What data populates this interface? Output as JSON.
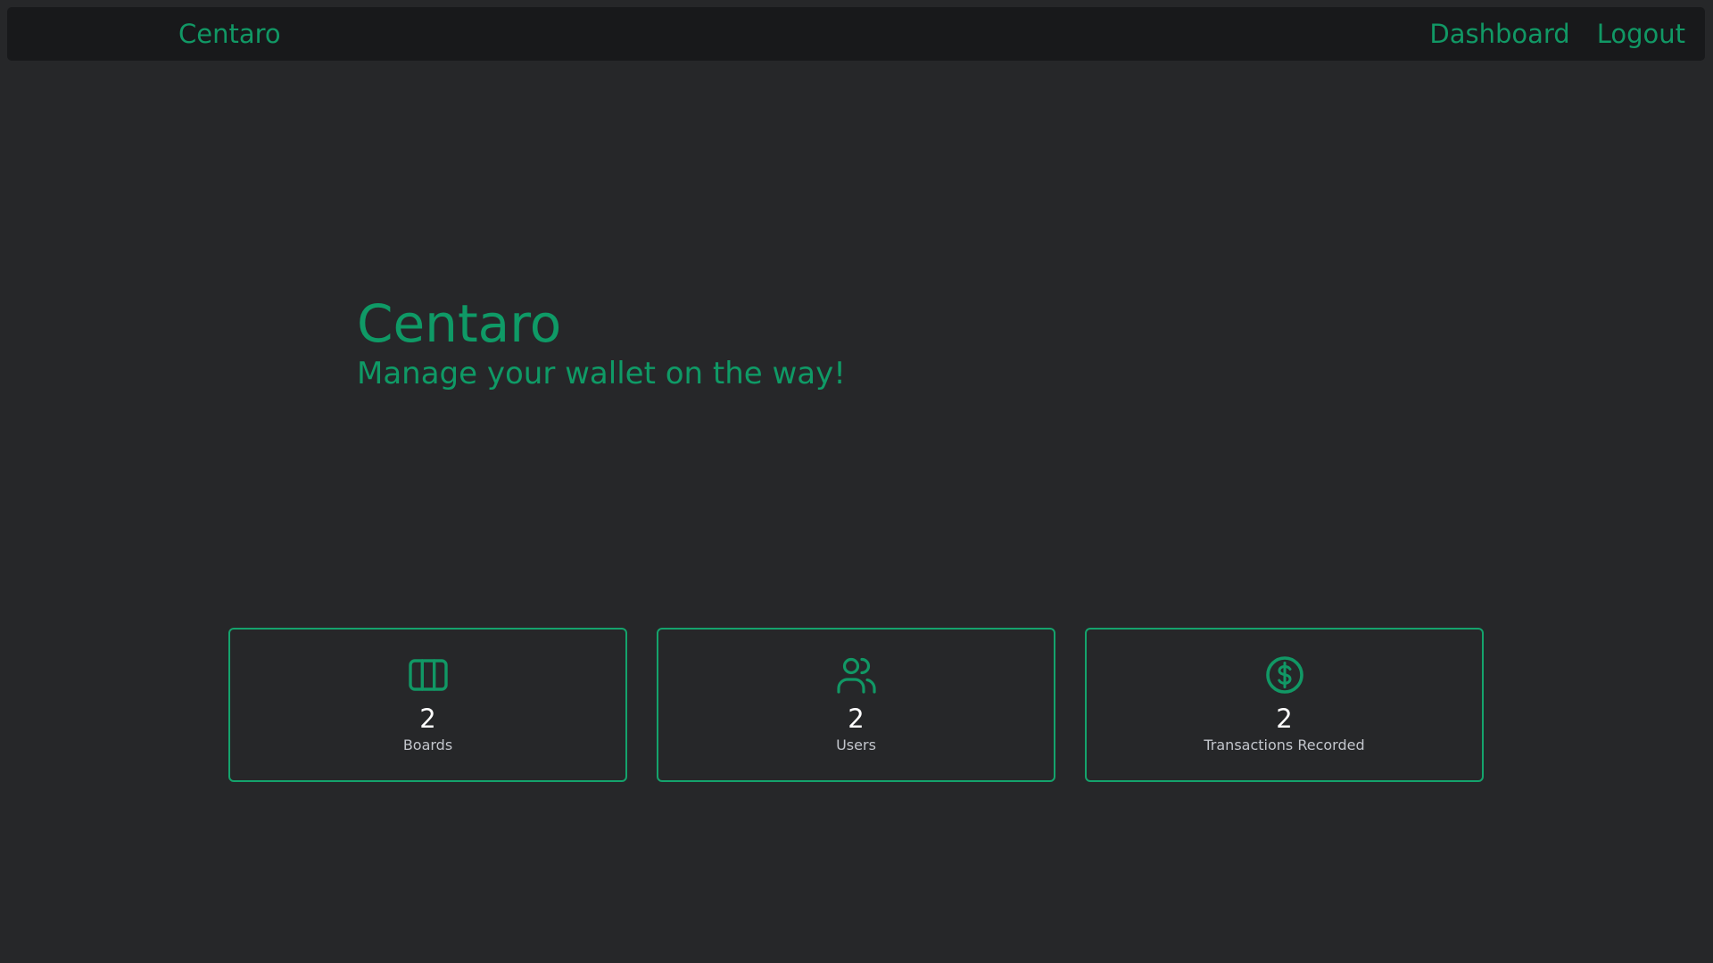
{
  "navbar": {
    "brand": "Centaro",
    "links": [
      "Dashboard",
      "Logout"
    ]
  },
  "hero": {
    "title": "Centaro",
    "subtitle": "Manage your wallet on the way!"
  },
  "stats": [
    {
      "icon": "board-columns-icon",
      "value": "2",
      "label": "Boards"
    },
    {
      "icon": "users-icon",
      "value": "2",
      "label": "Users"
    },
    {
      "icon": "dollar-coin-icon",
      "value": "2",
      "label": "Transactions Recorded"
    }
  ],
  "colors": {
    "accent": "#119865",
    "background": "#262729",
    "navbar": "#18191b",
    "card_border": "#14a36c"
  }
}
